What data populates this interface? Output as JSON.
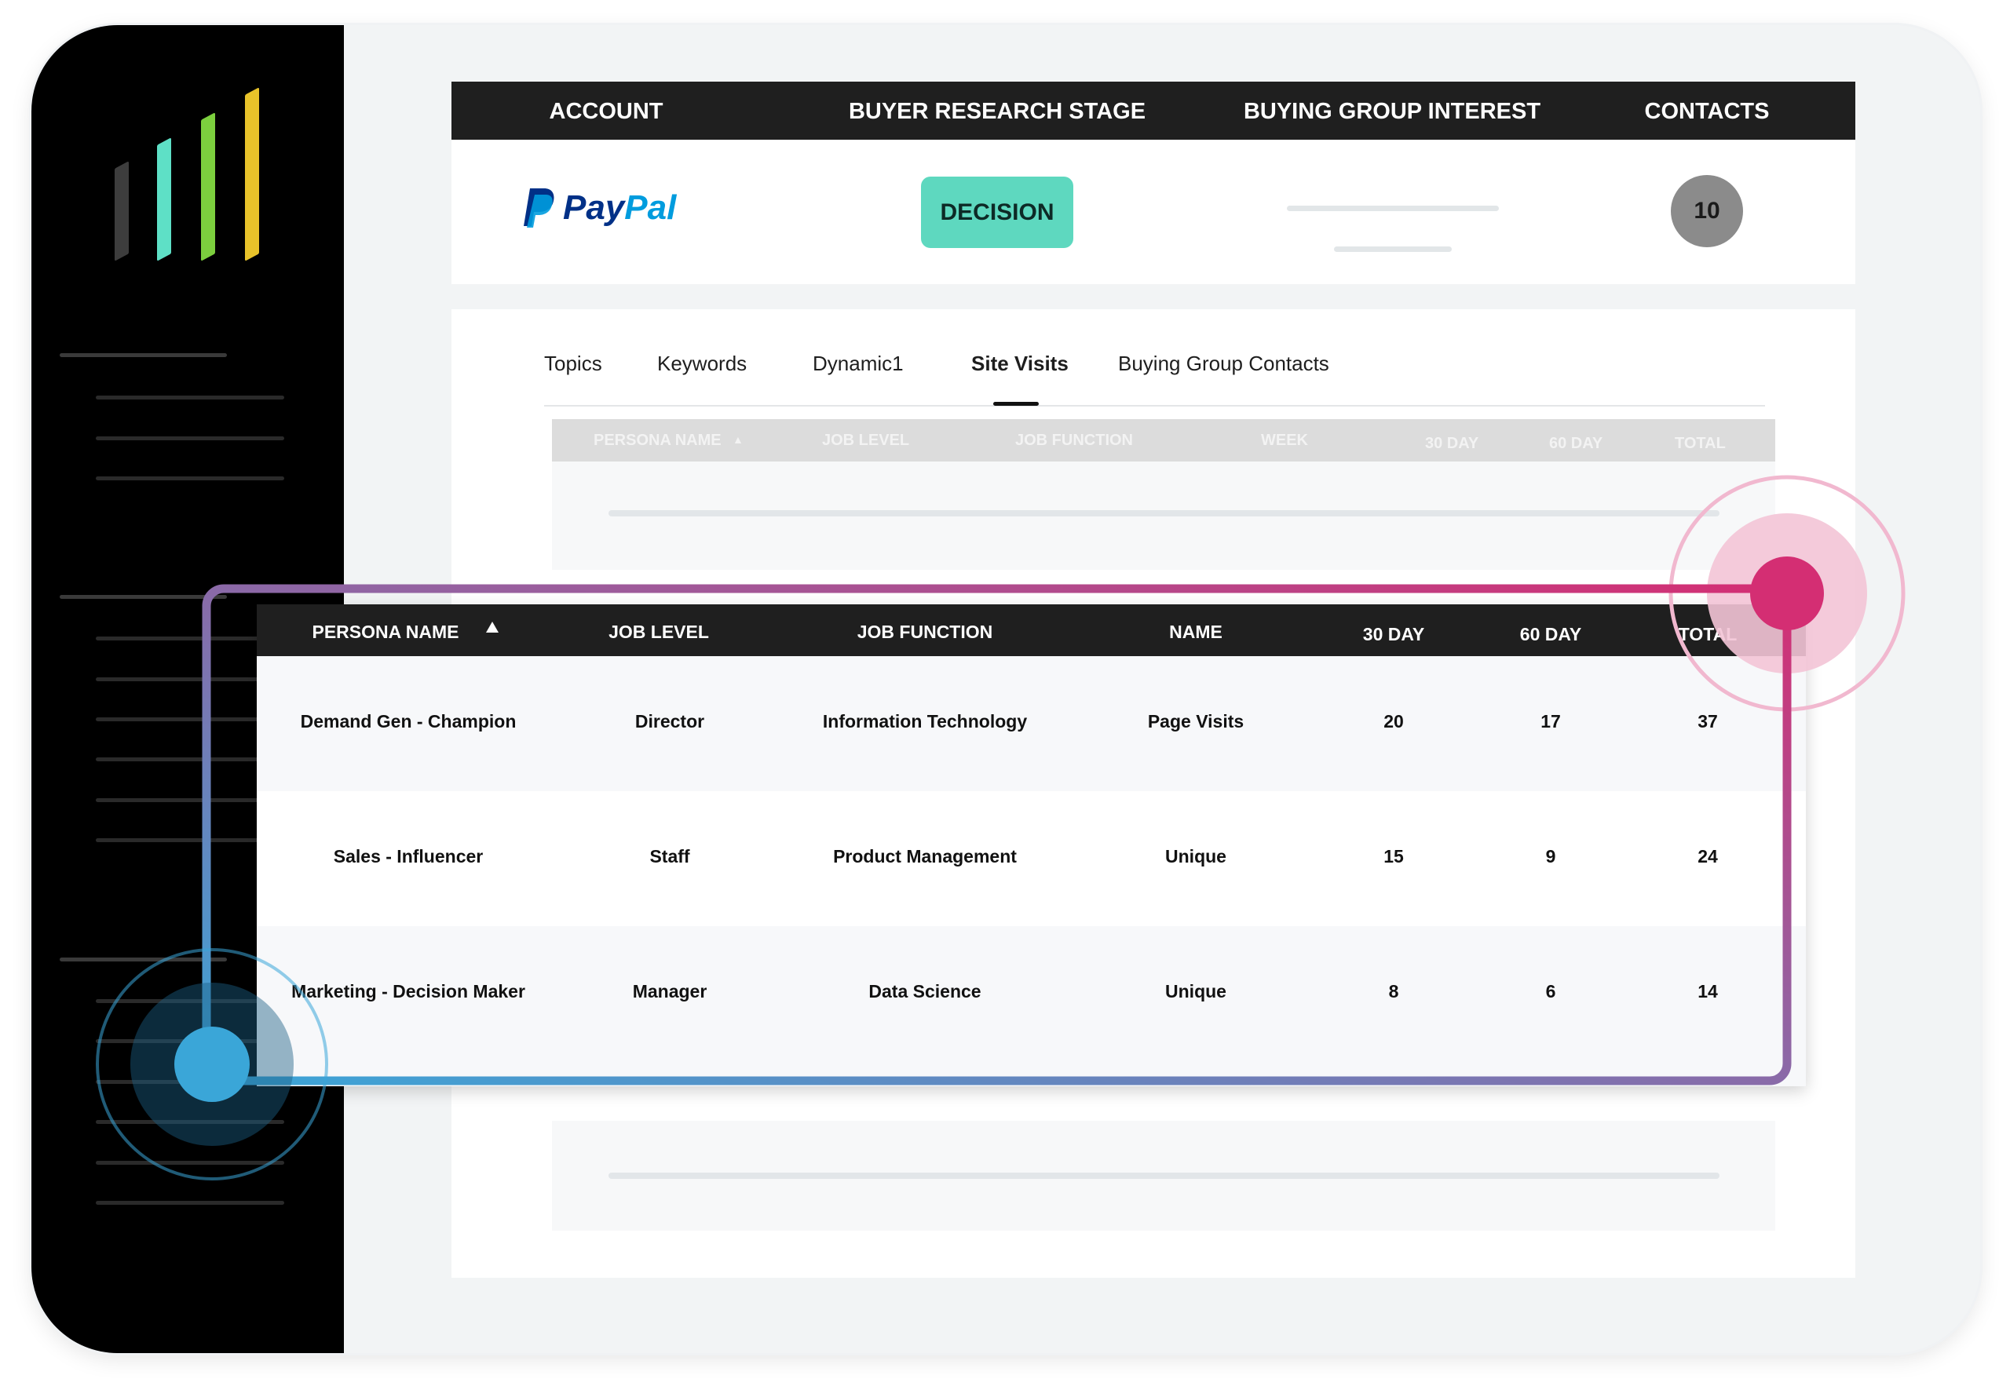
{
  "account_header": {
    "columns": [
      "ACCOUNT",
      "BUYER RESEARCH STAGE",
      "BUYING GROUP INTEREST",
      "CONTACTS"
    ]
  },
  "account_row": {
    "logo_text_dark": "Pay",
    "logo_text_light": "Pal",
    "stage": "DECISION",
    "contacts": "10"
  },
  "tabs": [
    "Topics",
    "Keywords",
    "Dynamic1",
    "Site Visits",
    "Buying Group Contacts"
  ],
  "active_tab": "Site Visits",
  "ghost_table": {
    "columns": [
      "PERSONA NAME",
      "JOB LEVEL",
      "JOB FUNCTION",
      "WEEK",
      "30 DAY",
      "60 DAY",
      "TOTAL"
    ]
  },
  "site_visits_table": {
    "columns": [
      "PERSONA NAME",
      "JOB LEVEL",
      "JOB FUNCTION",
      "NAME",
      "30 DAY",
      "60 DAY",
      "TOTAL"
    ],
    "rows": [
      [
        "Demand Gen - Champion",
        "Director",
        "Information Technology",
        "Page Visits",
        "20",
        "17",
        "37"
      ],
      [
        "Sales - Influencer",
        "Staff",
        "Product Management",
        "Unique",
        "15",
        "9",
        "24"
      ],
      [
        "Marketing - Decision Maker",
        "Manager",
        "Data Science",
        "Unique",
        "8",
        "6",
        "14"
      ]
    ]
  },
  "colors": {
    "stage_badge": "#5ed8bf",
    "sidebar_bars": [
      "#3d3d3d",
      "#5ee0c6",
      "#7ccf3e",
      "#e8c32a"
    ],
    "accent_pink": "#d42e73",
    "accent_blue": "#3aa6d8"
  }
}
